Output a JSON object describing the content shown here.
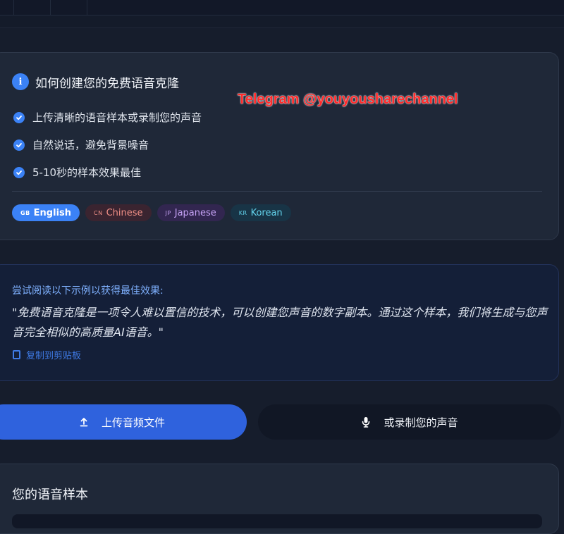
{
  "info": {
    "title": "如何创建您的免费语音克隆",
    "tips": [
      "上传清晰的语音样本或录制您的声音",
      "自然说话，避免背景噪音",
      "5-10秒的样本效果最佳"
    ],
    "languages": [
      {
        "code": "GB",
        "label": "English"
      },
      {
        "code": "CN",
        "label": "Chinese"
      },
      {
        "code": "JP",
        "label": "Japanese"
      },
      {
        "code": "KR",
        "label": "Korean"
      }
    ]
  },
  "watermark": "Telegram @youyousharechannel",
  "sample": {
    "hint": "尝试阅读以下示例以获得最佳效果:",
    "text": "\"免费语音克隆是一项令人难以置信的技术，可以创建您声音的数字副本。通过这个样本，我们将生成与您声音完全相似的高质量AI语音。\"",
    "copy_label": "复制到剪贴板"
  },
  "actions": {
    "upload_label": "上传音频文件",
    "record_label": "或录制您的声音"
  },
  "voice_samples": {
    "title": "您的语音样本"
  },
  "colors": {
    "accent": "#3b82f6",
    "upload_button": "#2f62dd",
    "watermark": "#ff2b2b"
  }
}
